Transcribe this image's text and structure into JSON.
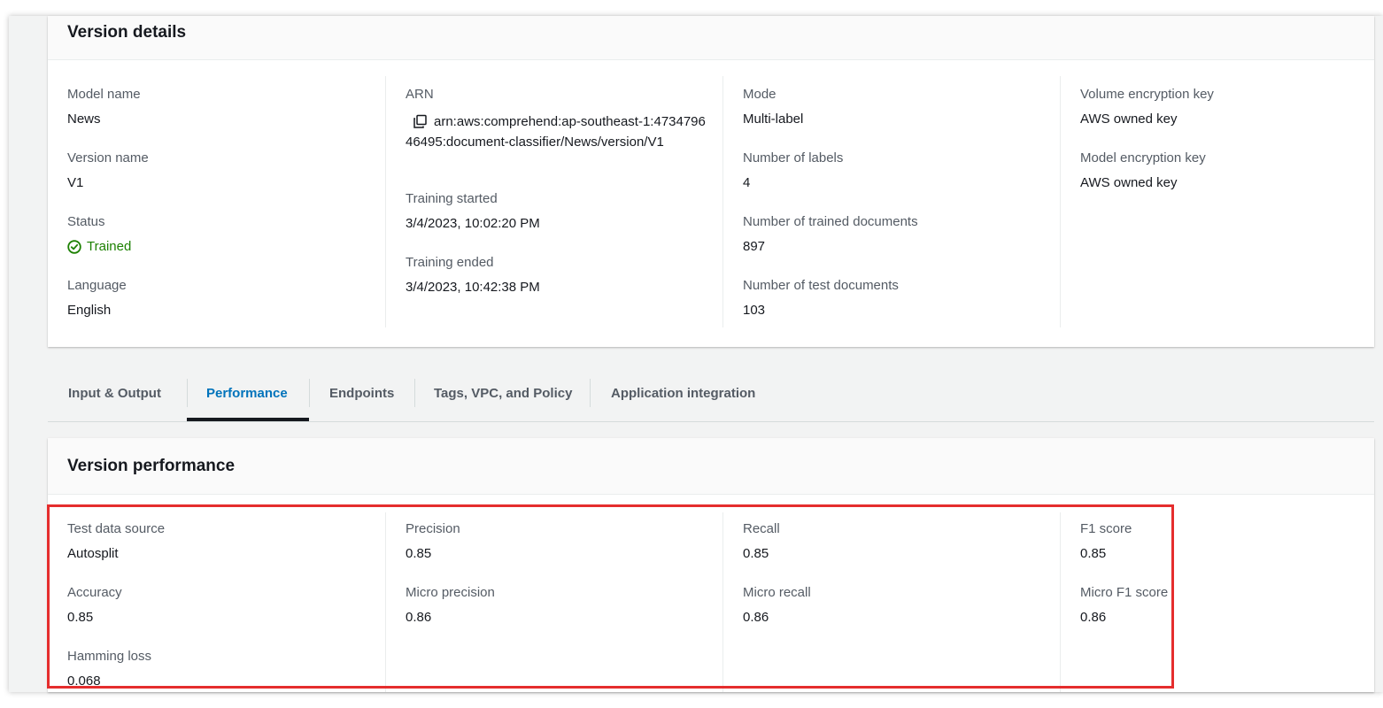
{
  "version_details": {
    "title": "Version details",
    "model_name_label": "Model name",
    "model_name": "News",
    "version_name_label": "Version name",
    "version_name": "V1",
    "status_label": "Status",
    "status": "Trained",
    "language_label": "Language",
    "language": "English",
    "arn_label": "ARN",
    "arn": "arn:aws:comprehend:ap-southeast-1:473479646495:document-classifier/News/version/V1",
    "training_started_label": "Training started",
    "training_started": "3/4/2023, 10:02:20 PM",
    "training_ended_label": "Training ended",
    "training_ended": "3/4/2023, 10:42:38 PM",
    "mode_label": "Mode",
    "mode": "Multi-label",
    "num_labels_label": "Number of labels",
    "num_labels": "4",
    "num_trained_label": "Number of trained documents",
    "num_trained": "897",
    "num_test_label": "Number of test documents",
    "num_test": "103",
    "volume_key_label": "Volume encryption key",
    "volume_key": "AWS owned key",
    "model_key_label": "Model encryption key",
    "model_key": "AWS owned key",
    "colors": {
      "status_green": "#1d8102"
    }
  },
  "tabs": [
    {
      "label": "Input & Output",
      "active": false
    },
    {
      "label": "Performance",
      "active": true
    },
    {
      "label": "Endpoints",
      "active": false
    },
    {
      "label": "Tags, VPC, and Policy",
      "active": false
    },
    {
      "label": "Application integration",
      "active": false
    }
  ],
  "tab_colors": {
    "active": "#0073bb",
    "inactive": "#545b64"
  },
  "performance": {
    "title": "Version performance",
    "test_source_label": "Test data source",
    "test_source": "Autosplit",
    "accuracy_label": "Accuracy",
    "accuracy": "0.85",
    "hamming_label": "Hamming loss",
    "hamming": "0.068",
    "precision_label": "Precision",
    "precision": "0.85",
    "micro_precision_label": "Micro precision",
    "micro_precision": "0.86",
    "recall_label": "Recall",
    "recall": "0.85",
    "micro_recall_label": "Micro recall",
    "micro_recall": "0.86",
    "f1_label": "F1 score",
    "f1": "0.85",
    "micro_f1_label": "Micro F1 score",
    "micro_f1": "0.86",
    "highlight_color": "#e52d2d"
  }
}
